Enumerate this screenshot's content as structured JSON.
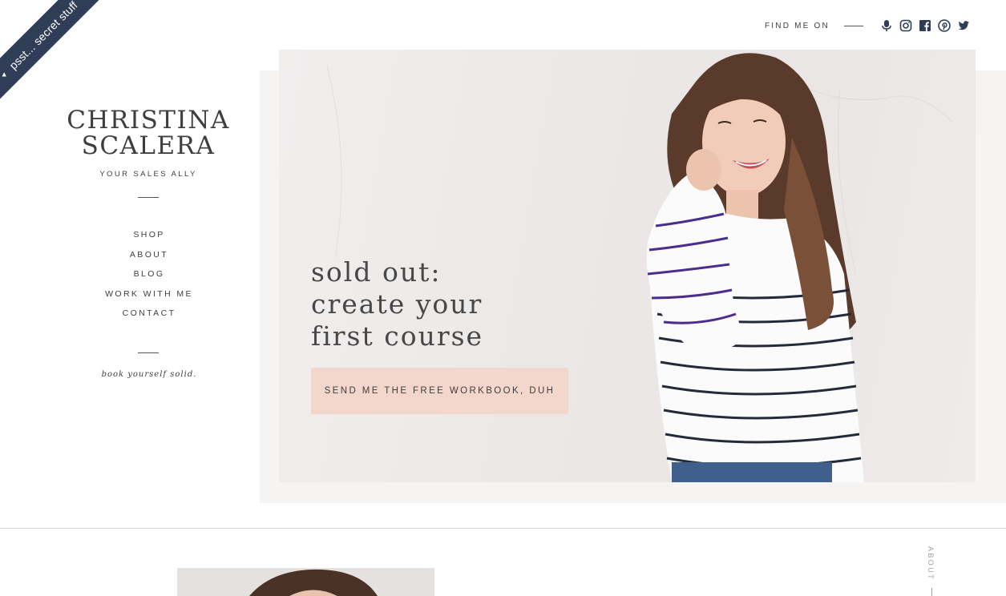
{
  "ribbon": {
    "label": "psst... secret stuff",
    "color": "#2f3d57",
    "icon": "triangle-icon"
  },
  "social": {
    "label": "FIND ME ON",
    "icons": [
      "microphone-icon",
      "instagram-icon",
      "facebook-icon",
      "pinterest-icon",
      "twitter-icon"
    ]
  },
  "brand": {
    "name_line1": "CHRISTINA",
    "name_line2": "SCALERA",
    "tagline": "YOUR SALES ALLY"
  },
  "nav": {
    "items": [
      "SHOP",
      "ABOUT",
      "BLOG",
      "WORK WITH ME",
      "CONTACT"
    ]
  },
  "motto": "book yourself solid.",
  "hero": {
    "title_lines": [
      "sold out:",
      "create your",
      "first course"
    ],
    "cta_label": "SEND ME THE FREE WORKBOOK, DUH",
    "cta_color": "#f4d7cc"
  },
  "about": {
    "side_label": "ABOUT"
  }
}
